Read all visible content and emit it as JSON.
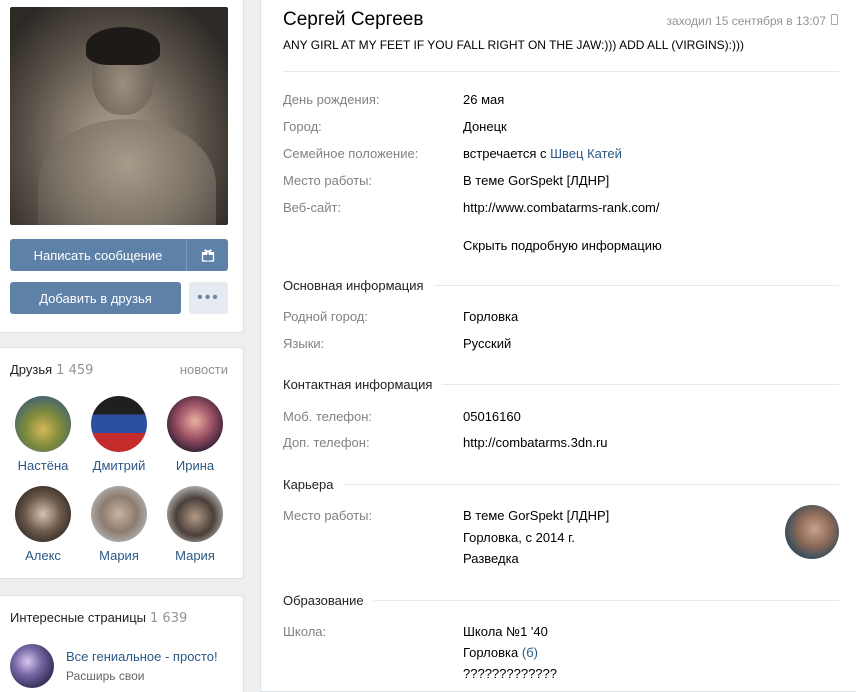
{
  "profile": {
    "name": "Сергей Сергеев",
    "online": "заходил 15 сентября в 13:07",
    "status": "ANY GIRL AT MY FEET IF YOU FALL RIGHT ON THE JAW:))) ADD ALL (VIRGINS):)))"
  },
  "actions": {
    "message": "Написать сообщение",
    "gift_icon": "gift-icon",
    "add_friend": "Добавить в друзья",
    "more": "•••"
  },
  "friends": {
    "title": "Друзья",
    "count": "1 459",
    "news_link": "новости",
    "items": [
      {
        "name": "Настёна"
      },
      {
        "name": "Дмитрий"
      },
      {
        "name": "Ирина"
      },
      {
        "name": "Алекс"
      },
      {
        "name": "Мария"
      },
      {
        "name": "Мария"
      }
    ]
  },
  "interesting": {
    "title": "Интересные страницы",
    "count": "1 639",
    "item_title": "Все гениальное - просто!",
    "item_sub": "Расширь свои"
  },
  "info": {
    "birthday_label": "День рождения:",
    "birthday_value": "26 мая",
    "city_label": "Город:",
    "city_value": "Донецк",
    "family_label": "Семейное положение:",
    "family_text": "встречается с ",
    "family_link": "Швец Катей",
    "work_label": "Место работы:",
    "work_value": "В теме GorSpekt [ЛДНР]",
    "site_label": "Веб-сайт:",
    "site_value": "http://www.combatarms-rank.com/",
    "hide_link": "Скрыть подробную информацию"
  },
  "basic": {
    "title": "Основная информация",
    "hometown_label": "Родной город:",
    "hometown_value": "Горловка",
    "languages_label": "Языки:",
    "languages_value": "Русский"
  },
  "contacts": {
    "title": "Контактная информация",
    "mobile_label": "Моб. телефон:",
    "mobile_value": "05016160",
    "extra_label": "Доп. телефон:",
    "extra_value": "http://combatarms.3dn.ru"
  },
  "career": {
    "title": "Карьера",
    "work_label": "Место работы:",
    "company": "В теме GorSpekt [ЛДНР]",
    "period": "Горловка, с 2014 г.",
    "position": "Разведка"
  },
  "education": {
    "title": "Образование",
    "school_label": "Школа:",
    "school_name": "Школа №1 '40",
    "city": "Горловка",
    "class": "(б)",
    "extra": "?????????????"
  }
}
